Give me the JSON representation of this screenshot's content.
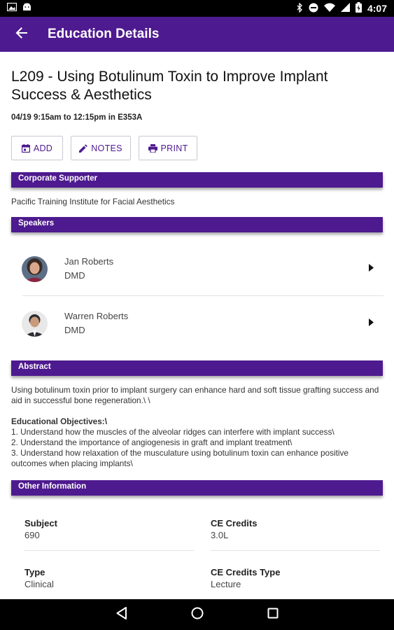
{
  "status_bar": {
    "time": "4:07"
  },
  "app_bar": {
    "title": "Education Details"
  },
  "session": {
    "title": "L209 - Using Botulinum Toxin to Improve Implant Success & Aesthetics",
    "time": "04/19 9:15am to 12:15pm in E353A"
  },
  "actions": {
    "add_label": "ADD",
    "notes_label": "NOTES",
    "print_label": "PRINT"
  },
  "corporate_supporter": {
    "header": "Corporate Supporter",
    "value": "Pacific Training Institute for Facial Aesthetics"
  },
  "speakers": {
    "header": "Speakers",
    "items": [
      {
        "name": "Jan Roberts",
        "credential": "DMD"
      },
      {
        "name": "Warren Roberts",
        "credential": "DMD"
      }
    ]
  },
  "abstract": {
    "header": "Abstract",
    "text": "Using botulinum toxin prior to implant surgery can enhance hard and soft tissue grafting success and aid in successful bone regeneration.\\ \\",
    "objectives_title": "Educational Objectives:\\",
    "objectives": [
      "1. Understand how the muscles of the alveolar ridges can interfere with implant success\\",
      "2. Understand the importance of angiogenesis in graft and implant treatment\\",
      "3. Understand how relaxation of the musculature using botulinum toxin can enhance positive outcomes when placing implants\\"
    ]
  },
  "other_info": {
    "header": "Other Information",
    "subject_label": "Subject",
    "subject_value": "690",
    "credits_label": "CE Credits",
    "credits_value": "3.0L",
    "type_label": "Type",
    "type_value": "Clinical",
    "credits_type_label": "CE Credits Type",
    "credits_type_value": "Lecture"
  },
  "colors": {
    "primary": "#4e1a8f",
    "status_bar": "#000000"
  }
}
